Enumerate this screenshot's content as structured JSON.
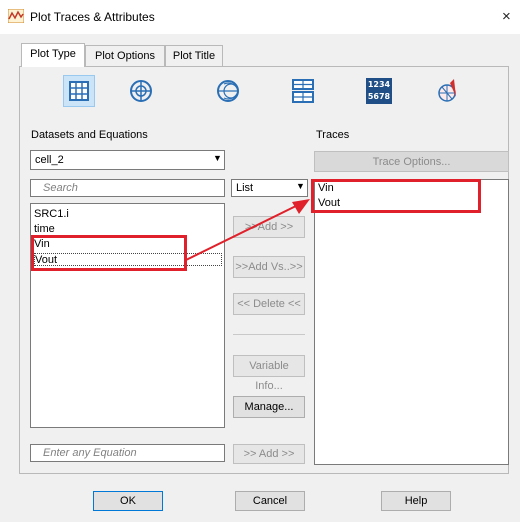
{
  "window": {
    "title": "Plot Traces & Attributes",
    "close": "×"
  },
  "tabs": [
    {
      "label": "Plot Type"
    },
    {
      "label": "Plot Options"
    },
    {
      "label": "Plot Title"
    }
  ],
  "plot_types": [
    {
      "name": "rectangular-grid-icon",
      "selected": true
    },
    {
      "name": "polar-icon",
      "selected": false
    },
    {
      "name": "smith-chart-icon",
      "selected": false
    },
    {
      "name": "stacked-rectangular-icon",
      "selected": false
    },
    {
      "name": "data-list-icon",
      "text_top": "1234",
      "text_bottom": "5678",
      "selected": false
    },
    {
      "name": "antenna-icon",
      "selected": false
    }
  ],
  "left": {
    "section_label": "Datasets and Equations",
    "dataset_selected": "cell_2",
    "search_placeholder": "Search",
    "variables": [
      "SRC1.i",
      "time",
      "Vin",
      "Vout"
    ],
    "equation_placeholder": "Enter any Equation"
  },
  "middle": {
    "view_selected": "List",
    "add_button": ">>Add >>",
    "add_vs_button": ">>Add Vs..>>",
    "delete_button": "<< Delete <<",
    "variable_info_button": "Variable Info...",
    "manage_button": "Manage...",
    "add_equation_button": ">> Add >>"
  },
  "right": {
    "section_label": "Traces",
    "trace_options_button": "Trace Options...",
    "traces": [
      "Vin",
      "Vout"
    ]
  },
  "footer": {
    "ok": "OK",
    "cancel": "Cancel",
    "help": "Help"
  },
  "colors": {
    "annotation": "#e0202a",
    "selection": "#cce4f7",
    "icon_blue": "#2a6fb5"
  }
}
